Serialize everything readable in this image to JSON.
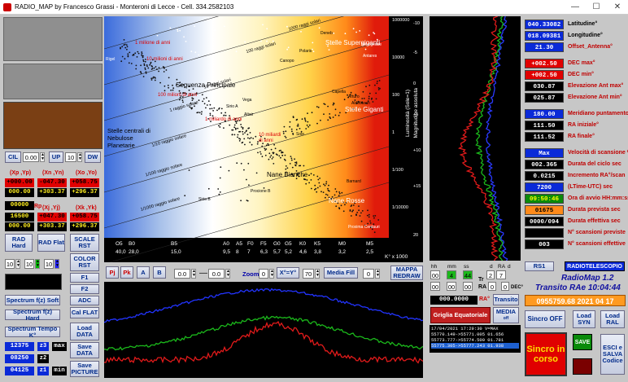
{
  "window": {
    "title": "RADIO_MAP by Francesco Grassi - Monteroni di Lecce - Cell. 334.2582103",
    "minimize": "—",
    "maximize": "☐",
    "close": "✕"
  },
  "left": {
    "cil_label": "CIL",
    "cil_value": "0.00",
    "up_label": "UP",
    "up_value": "10",
    "dw_label": "DW",
    "xp_yp_label": "(Xp ,Yp)",
    "xn_yn_label": "(Xn ,Yn)",
    "xo_yo_label": "(Xo ,Yo)",
    "row1": [
      "+000.00",
      "-047.30",
      "+058.75"
    ],
    "row2": [
      "000.00",
      "+303.37",
      "+296.37"
    ],
    "rp_label": "Rp",
    "xj_yj_label": "(Xj ,Yj)",
    "xk_yk_label": "(Xk ,Yk)",
    "rp_value": "00000",
    "row3": [
      "16500",
      "+047.30",
      "+058.75"
    ],
    "row4": [
      "000.00",
      "+303.37",
      "+296.37"
    ],
    "rad_hard": "RAD Hard",
    "rad_flat": "RAD Flat",
    "scale_rst": "SCALE RST",
    "color_rst": "COLOR RST",
    "c1": "10",
    "c2": "10",
    "c3": "10",
    "f1": "F1",
    "f2": "F2",
    "adc": "ADC",
    "cal_flat": "Cal FLAT",
    "load_data": "Load DATA",
    "save_data": "Save DATA",
    "save_picture": "Save PICTURE",
    "spectrum_soft": "Spectrum f(z) Soft",
    "spectrum_hard": "Spectrum f(z) Hard",
    "spectrum_tempo": "Spectrum Tempo K°",
    "v1": "12375",
    "z3": "z3",
    "max": "max",
    "v2": "08250",
    "z2": "z2",
    "v3": "04125",
    "z1": "z1",
    "min": "min"
  },
  "hr": {
    "lum_axis": "Luminosità (Sole=1)",
    "mag_axis": "Magnitudine assoluta",
    "region_sg": "Stelle Supergiganti",
    "region_ms": "Sequenza Principale",
    "region_g": "Stelle Giganti",
    "region_wd": "Nane Bianche",
    "region_rd": "Nane Rosse",
    "region_pn": "Stelle centrali di Nebulose Planetarie",
    "lum_ticks": [
      "1000000",
      "10000",
      "100",
      "1",
      "1/100",
      "1/10000"
    ],
    "mag_ticks": [
      "-10",
      "-5",
      "0",
      "+5",
      "+10",
      "+15",
      "20"
    ],
    "spec_classes": [
      "O5",
      "B0",
      "B5",
      "A0",
      "A5",
      "F0",
      "F5",
      "G0",
      "G5",
      "K0",
      "K5",
      "M0",
      "M5"
    ],
    "temps": [
      "40,0",
      "28,0",
      "15,0",
      "9,5",
      "8",
      "7",
      "6,3",
      "5,7",
      "5,2",
      "4,6",
      "3,8",
      "3,2",
      "2,5"
    ],
    "temp_unit": "K° x 1000",
    "ages": [
      "1 milione di anni",
      "10 milioni di anni",
      "100 milioni di anni",
      "1 miliardo di anni",
      "10 miliardi di anni"
    ],
    "radii": [
      "1000 raggi solari",
      "100 raggi solari",
      "10 raggi solari",
      "1 raggio solare",
      "1/10 raggio solare",
      "1/100 raggio solare",
      "1/1000 raggio solare"
    ],
    "stars": [
      "Rigel",
      "Deneb",
      "Betelgeuse",
      "Antares",
      "Polaris",
      "Canopo",
      "Sirio A",
      "Vega",
      "Altair",
      "Sole",
      "Arturo",
      "Aldebaran",
      "Capella",
      "Procione B",
      "Sirio B",
      "Barnard",
      "Proxima Centauri"
    ]
  },
  "toolbar": {
    "pj": "Pj",
    "pk": "Pk",
    "a": "A",
    "b": "B",
    "v1": "0.0",
    "v2": "0.0",
    "zoom_label": "Zoom",
    "zoom": "0",
    "xy": "X°=Y°",
    "v70": "70",
    "media_fill": "Media Fill",
    "mf_value": "0",
    "mappa_redraw": "MAPPA REDRAW"
  },
  "mid": {
    "hh": "hh",
    "mm": "mm",
    "ss": "ss",
    "tr": "Tr",
    "d": "d",
    "ra": "RA",
    "d2": "d",
    "h1": "00",
    "m1": "4",
    "s1": "44",
    "tr_value": "2",
    "d_val": "7",
    "h2": "00",
    "m2": "00",
    "s2": "00",
    "ra_value": "0",
    "d2_value": "0",
    "dec_label": "DEC°",
    "rad_value": "000.0000",
    "rad_label": "RA°",
    "transito": "Transito",
    "griglia": "Griglia Equatoriale",
    "media": "MEDIA",
    "media_sub": "off",
    "log": [
      "17/04/2021 17:29:30  V=MAX",
      "55770.149->55771.005  01.656",
      "55773.777->55774.500  01.781",
      "55775.305->55777.243  01.938"
    ]
  },
  "right": {
    "latitudine": "040.33082",
    "latitudine_label": "Latitudine°",
    "longitudine": "018.09381",
    "longitudine_label": "Longitudine°",
    "offset": "21.30",
    "offset_label": "Offset_Antenna°",
    "dec_max": "+002.50",
    "dec_max_label": "DEC max°",
    "dec_min": "+002.50",
    "dec_min_label": "DEC min°",
    "elev_max": "030.87",
    "elev_max_label": "Elevazione Ant max°",
    "elev_min": "025.87",
    "elev_min_label": "Elevazione Ant min°",
    "meridiano": "180.00",
    "meridiano_label": "Meridiano puntamento°",
    "ra_ini": "111.50",
    "ra_ini_label": "RA iniziale°",
    "ra_fin": "111.52",
    "ra_fin_label": "RA finale°",
    "max_btn": "Max",
    "velocita_label": "Velocità di scansione %",
    "durata_ciclo": "002.365",
    "durata_ciclo_label": "Durata del ciclo sec",
    "incremento": "0.0215",
    "incremento_label": "Incremento RA°/scan",
    "ltime": "7200",
    "ltime_label": "(LTime-UTC) sec",
    "ora_avvio": "09:50:46",
    "ora_avvio_label": "Ora di avvio HH:mm:ss",
    "durata_prevista": "01675",
    "durata_prevista_label": "Durata prevista sec",
    "durata_eff": "0000/094",
    "durata_eff_label": "Durata effettiva sec",
    "scansioni_prev_label": "N° scansioni previste",
    "scansioni_eff": "003",
    "scansioni_eff_label": "N° scansioni effettive",
    "rs1": "RS1",
    "radiotelescopio": "RADIOTELESCOPIO",
    "app_name": "RadioMap 1.2",
    "transit": "Transito RAe 10:04:44",
    "datetime": "0955759.68 2021 04 17",
    "sincro_off": "Sincro OFF",
    "load_syn": "Load SYN",
    "load_ral": "Load RAL",
    "sincro_in_corso": "Sincro in corso",
    "save": "SAVE",
    "esci": "ESCI e SALVA Codice"
  }
}
